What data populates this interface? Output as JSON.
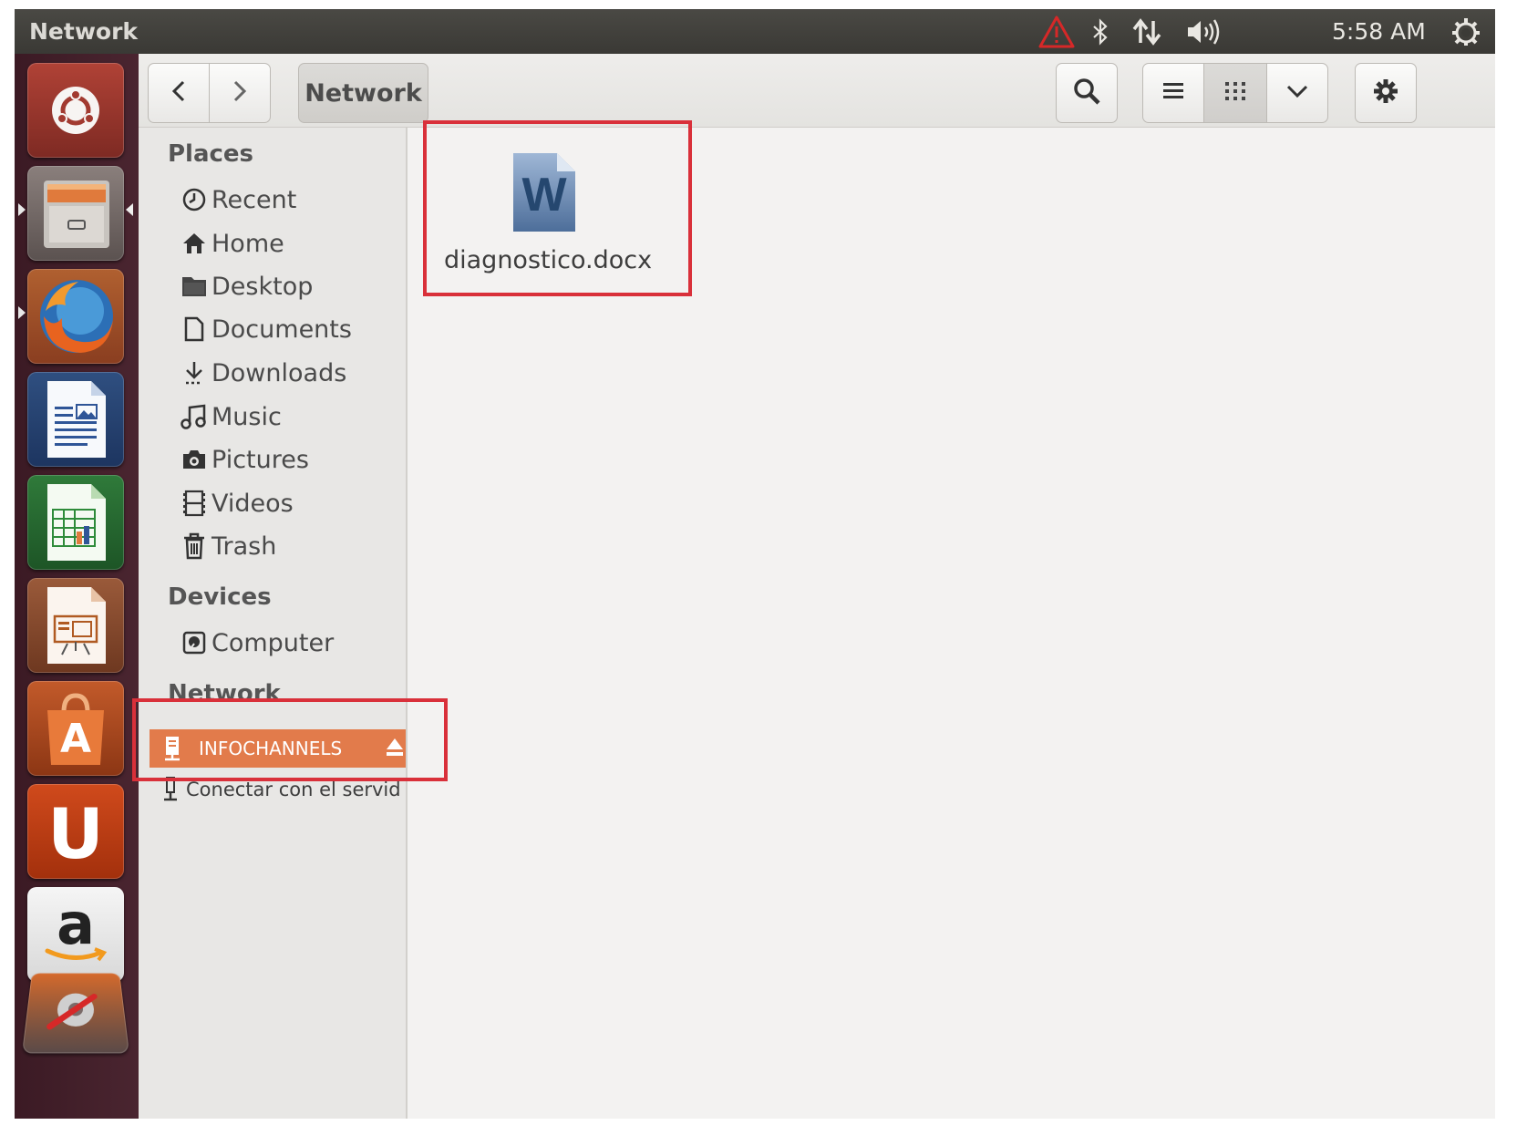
{
  "window": {
    "title": "Network"
  },
  "panel": {
    "clock": "5:58 AM",
    "tray_icons": [
      "warning-icon",
      "bluetooth-icon",
      "network-arrows-icon",
      "volume-icon",
      "power-icon"
    ]
  },
  "launcher": {
    "items": [
      "ubuntu-dash",
      "files",
      "firefox",
      "libreoffice-writer",
      "libreoffice-calc",
      "libreoffice-impress",
      "ubuntu-software-center",
      "ubuntu-one",
      "amazon",
      "system-settings"
    ],
    "amazon_glyph": "a",
    "ubuntu_one_glyph": "U",
    "software_center_glyph": "A"
  },
  "toolbar": {
    "path_button": "Network",
    "icons": [
      "back-icon",
      "forward-icon",
      "search-icon",
      "list-view-icon",
      "grid-view-icon",
      "chevron-down-icon",
      "gear-icon"
    ]
  },
  "sidebar": {
    "places_header": "Places",
    "places": [
      {
        "label": "Recent",
        "icon": "clock-icon"
      },
      {
        "label": "Home",
        "icon": "home-icon"
      },
      {
        "label": "Desktop",
        "icon": "folder-icon"
      },
      {
        "label": "Documents",
        "icon": "document-icon"
      },
      {
        "label": "Downloads",
        "icon": "download-icon"
      },
      {
        "label": "Music",
        "icon": "music-icon"
      },
      {
        "label": "Pictures",
        "icon": "camera-icon"
      },
      {
        "label": "Videos",
        "icon": "film-icon"
      },
      {
        "label": "Trash",
        "icon": "trash-icon"
      }
    ],
    "devices_header": "Devices",
    "devices": [
      {
        "label": "Computer",
        "icon": "computer-icon"
      }
    ],
    "network_header": "Network",
    "network": [
      {
        "label": "INFOCHANNELS",
        "icon": "server-icon",
        "selected": true
      },
      {
        "label": "Conectar con el servidor",
        "icon": "connect-icon"
      }
    ]
  },
  "content": {
    "files": [
      {
        "name": "diagnostico.docx",
        "icon": "word-document-icon",
        "glyph": "W"
      }
    ]
  },
  "colors": {
    "selection": "#e27b4b",
    "highlight_box": "#d9303a",
    "panel": "#3c3b37",
    "launcher": "#42202a"
  }
}
